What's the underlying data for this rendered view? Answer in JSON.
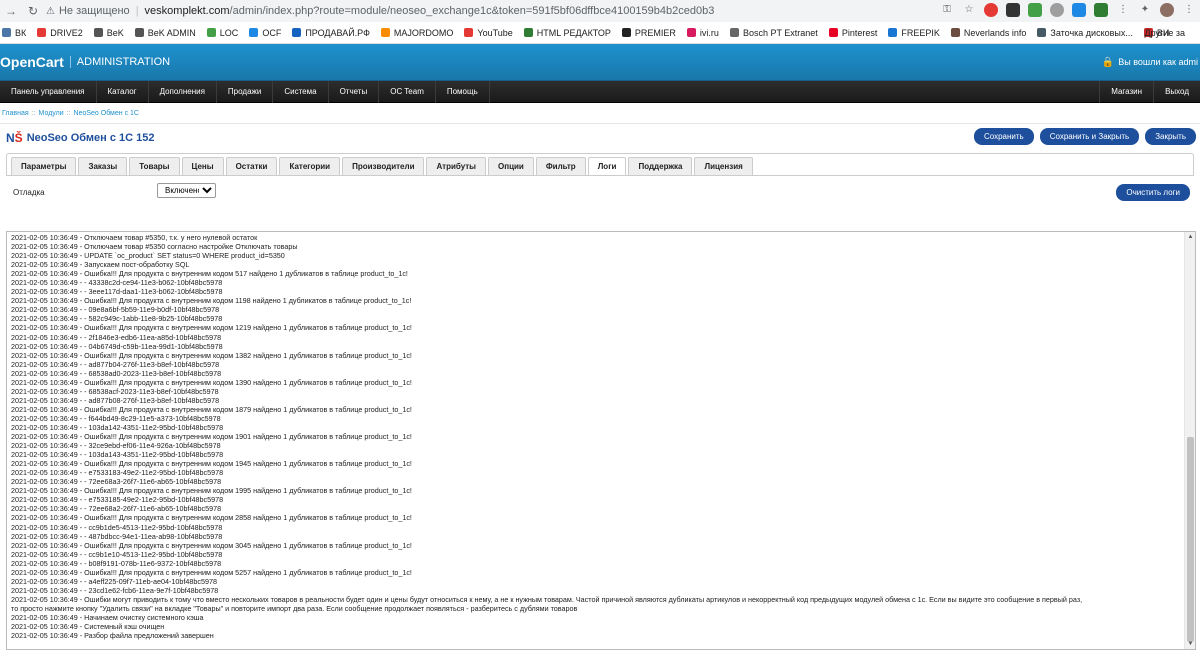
{
  "browser": {
    "secure_text": "Не защищено",
    "url_host": "veskomplekt.com",
    "url_path": "/admin/index.php?route=module/neoseo_exchange1c&token=591f5bf06dffbce4100159b4b2ced0b3"
  },
  "bookmarks": [
    {
      "label": "ВК",
      "color": "#4a76a8"
    },
    {
      "label": "DRIVE2",
      "color": "#e53935"
    },
    {
      "label": "BeK",
      "color": "#555555"
    },
    {
      "label": "BeK ADMIN",
      "color": "#555555"
    },
    {
      "label": "LOC",
      "color": "#43a047"
    },
    {
      "label": "OCF",
      "color": "#1e88e5"
    },
    {
      "label": "ПРОДАВАЙ.РФ",
      "color": "#1565c0"
    },
    {
      "label": "MAJORDOMO",
      "color": "#fb8c00"
    },
    {
      "label": "YouTube",
      "color": "#e53935"
    },
    {
      "label": "HTML РЕДАКТОР",
      "color": "#2e7d32"
    },
    {
      "label": "PREMIER",
      "color": "#222222"
    },
    {
      "label": "ivi.ru",
      "color": "#d81b60"
    },
    {
      "label": "Bosch PT Extranet",
      "color": "#666666"
    },
    {
      "label": "Pinterest",
      "color": "#e60023"
    },
    {
      "label": "FREEPIK",
      "color": "#1976d2"
    },
    {
      "label": "Neverlands info",
      "color": "#6d4c41"
    },
    {
      "label": "Заточка дисковых...",
      "color": "#455a64"
    },
    {
      "label": "ВИ",
      "color": "#c62828"
    }
  ],
  "other_bookmarks": "Другие за",
  "header": {
    "logo": "OpenCart",
    "admin": "ADMINISTRATION",
    "user_text": "Вы вошли как admi"
  },
  "menu": {
    "items": [
      "Панель управления",
      "Каталог",
      "Дополнения",
      "Продажи",
      "Система",
      "Отчеты",
      "OC Team",
      "Помощь"
    ],
    "right": [
      "Магазин",
      "Выход"
    ]
  },
  "breadcrumb": [
    "Главная",
    "Модули",
    "NeoSeo Обмен с 1С"
  ],
  "page": {
    "logo_n": "N",
    "logo_s": "Š",
    "title": "NeoSeo Обмен с 1С 152",
    "save": "Сохранить",
    "save_close": "Сохранить и Закрыть",
    "close": "Закрыть"
  },
  "tabs": [
    "Параметры",
    "Заказы",
    "Товары",
    "Цены",
    "Остатки",
    "Категории",
    "Производители",
    "Атрибуты",
    "Опции",
    "Фильтр",
    "Логи",
    "Поддержка",
    "Лицензия"
  ],
  "active_tab": "Логи",
  "debug": {
    "label": "Отладка",
    "value": "Включено",
    "clear_button": "Очистить логи"
  },
  "log": [
    "2021-02-05 10:36:49 - Отключаем товар #5350, т.к. у него нулевой остаток",
    "2021-02-05 10:36:49 - Отключаем товар #5350 согласно настройке Отключать товары",
    "2021-02-05 10:36:49 - UPDATE `oc_product` SET status=0 WHERE product_id=5350",
    "2021-02-05 10:36:49 - Запускаем пост-обработку SQL",
    "2021-02-05 10:36:49 - Ошибка!!! Для продукта с внутренним кодом 517 найдено 1 дубликатов в таблице product_to_1c!",
    "2021-02-05 10:36:49 - - 43338c2d-ce94-11e3-b062-10bf48bc5978",
    "2021-02-05 10:36:49 - - 3eee117d-daa1-11e3-b062-10bf48bc5978",
    "2021-02-05 10:36:49 - Ошибка!!! Для продукта с внутренним кодом 1198 найдено 1 дубликатов в таблице product_to_1c!",
    "2021-02-05 10:36:49 - - 09e8a6bf-5b59-11e9-b0df-10bf48bc5978",
    "2021-02-05 10:36:49 - - 582c949c-1abb-11e8-9b25-10bf48bc5978",
    "2021-02-05 10:36:49 - Ошибка!!! Для продукта с внутренним кодом 1219 найдено 1 дубликатов в таблице product_to_1c!",
    "2021-02-05 10:36:49 - - 2f1846e3-edb6-11ea-a85d-10bf48bc5978",
    "2021-02-05 10:36:49 - - 04b6749d-c59b-11ea-99d1-10bf48bc5978",
    "2021-02-05 10:36:49 - Ошибка!!! Для продукта с внутренним кодом 1382 найдено 1 дубликатов в таблице product_to_1c!",
    "2021-02-05 10:36:49 - - ad877b04-276f-11e3-b8ef-10bf48bc5978",
    "2021-02-05 10:36:49 - - 68538ad0-2023-11e3-b8ef-10bf48bc5978",
    "2021-02-05 10:36:49 - Ошибка!!! Для продукта с внутренним кодом 1390 найдено 1 дубликатов в таблице product_to_1c!",
    "2021-02-05 10:36:49 - - 68538acf-2023-11e3-b8ef-10bf48bc5978",
    "2021-02-05 10:36:49 - - ad877b08-276f-11e3-b8ef-10bf48bc5978",
    "2021-02-05 10:36:49 - Ошибка!!! Для продукта с внутренним кодом 1879 найдено 1 дубликатов в таблице product_to_1c!",
    "2021-02-05 10:36:49 - - f644bd49-8c29-11e5-a373-10bf48bc5978",
    "2021-02-05 10:36:49 - - 103da142-4351-11e2-95bd-10bf48bc5978",
    "2021-02-05 10:36:49 - Ошибка!!! Для продукта с внутренним кодом 1901 найдено 1 дубликатов в таблице product_to_1c!",
    "2021-02-05 10:36:49 - - 32ce9ebd-ef06-11e4-926a-10bf48bc5978",
    "2021-02-05 10:36:49 - - 103da143-4351-11e2-95bd-10bf48bc5978",
    "2021-02-05 10:36:49 - Ошибка!!! Для продукта с внутренним кодом 1945 найдено 1 дубликатов в таблице product_to_1c!",
    "2021-02-05 10:36:49 - - e7533183-49e2-11e2-95bd-10bf48bc5978",
    "2021-02-05 10:36:49 - - 72ee68a3-26f7-11e6-ab65-10bf48bc5978",
    "2021-02-05 10:36:49 - Ошибка!!! Для продукта с внутренним кодом 1995 найдено 1 дубликатов в таблице product_to_1c!",
    "2021-02-05 10:36:49 - - e7533185-49e2-11e2-95bd-10bf48bc5978",
    "2021-02-05 10:36:49 - - 72ee68a2-26f7-11e6-ab65-10bf48bc5978",
    "2021-02-05 10:36:49 - Ошибка!!! Для продукта с внутренним кодом 2858 найдено 1 дубликатов в таблице product_to_1c!",
    "2021-02-05 10:36:49 - - cc9b1de5-4513-11e2-95bd-10bf48bc5978",
    "2021-02-05 10:36:49 - - 487bdbcc-94e1-11ea-ab98-10bf48bc5978",
    "2021-02-05 10:36:49 - Ошибка!!! Для продукта с внутренним кодом 3045 найдено 1 дубликатов в таблице product_to_1c!",
    "2021-02-05 10:36:49 - - cc9b1e10-4513-11e2-95bd-10bf48bc5978",
    "2021-02-05 10:36:49 - - b08f9191-078b-11e6-9372-10bf48bc5978",
    "2021-02-05 10:36:49 - Ошибка!!! Для продукта с внутренним кодом 5257 найдено 1 дубликатов в таблице product_to_1c!",
    "2021-02-05 10:36:49 - - a4eff225-09f7-11eb-ae04-10bf48bc5978",
    "2021-02-05 10:36:49 - - 23cd1e62-fcb6-11ea-9e7f-10bf48bc5978",
    "2021-02-05 10:36:49 - Ошибки могут приводить к тому что вместо нескольких товаров в реальности будет один и цены будут относиться к нему, а не к нужным товарам. Частой причиной являются дубликаты артикулов и некорректный код предыдущих модулей обмена с 1с. Если вы видите это сообщение в первый раз,",
    "то просто нажмите кнопку \"Удалить связи\" на вкладке \"Товары\" и повторите импорт два раза. Если сообщение продолжает появляться - разберитесь с дублями товаров",
    "2021-02-05 10:36:49 - Начинаем очистку системного кэша",
    "2021-02-05 10:36:49 - Системный кэш очищен",
    "2021-02-05 10:36:49 - Разбор файла предложений завершен"
  ]
}
